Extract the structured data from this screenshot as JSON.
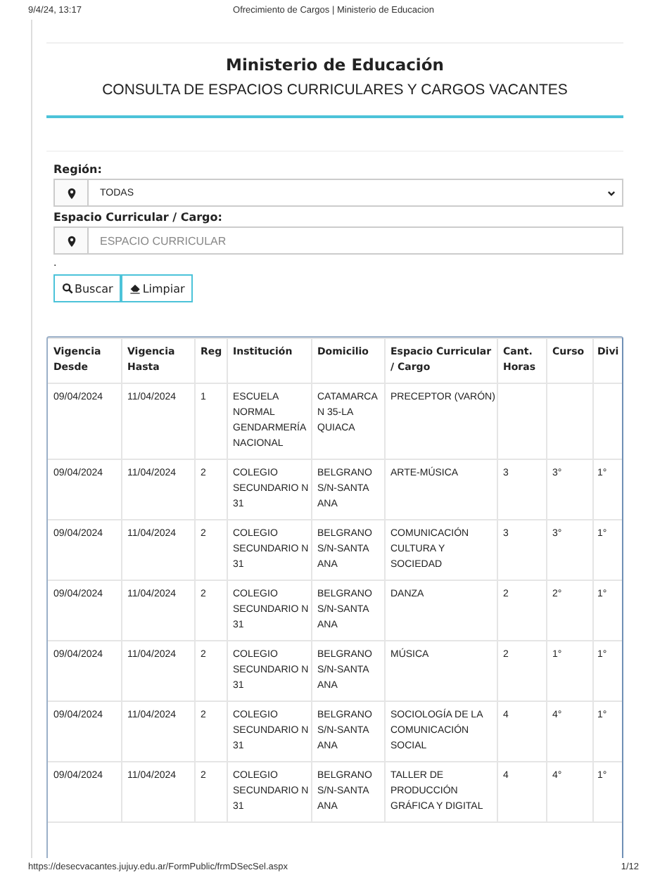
{
  "print_header": {
    "date": "9/4/24, 13:17",
    "title": "Ofrecimiento de Cargos | Ministerio de Educacion"
  },
  "heading": {
    "title": "Ministerio de Educación",
    "subtitle": "CONSULTA DE ESPACIOS CURRICULARES Y CARGOS VACANTES"
  },
  "form": {
    "fields": [
      {
        "kind": "select",
        "label": "Región:",
        "value": "TODAS"
      },
      {
        "kind": "text",
        "label": "Espacio Curricular / Cargo:",
        "placeholder": "ESPACIO CURRICULAR"
      }
    ],
    "note": ".",
    "buttons": [
      {
        "kind": "search",
        "label": "Buscar"
      },
      {
        "kind": "clear",
        "label": "Limpiar"
      }
    ]
  },
  "table": {
    "columns": [
      "Vigencia Desde",
      "Vigencia Hasta",
      "Reg",
      "Institución",
      "Domicilio",
      "Espacio Curricular / Cargo",
      "Cant. Horas",
      "Curso",
      "Divi"
    ],
    "rows": [
      [
        "09/04/2024",
        "11/04/2024",
        "1",
        "ESCUELA NORMAL GENDARMERÍA NACIONAL",
        "CATAMARCA N 35-LA QUIACA",
        "PRECEPTOR (VARÓN)",
        "",
        "",
        ""
      ],
      [
        "09/04/2024",
        "11/04/2024",
        "2",
        "COLEGIO SECUNDARIO N 31",
        "BELGRANO S/N-SANTA ANA",
        "ARTE-MÚSICA",
        "3",
        "3°",
        "1°"
      ],
      [
        "09/04/2024",
        "11/04/2024",
        "2",
        "COLEGIO SECUNDARIO N 31",
        "BELGRANO S/N-SANTA ANA",
        "COMUNICACIÓN CULTURA Y SOCIEDAD",
        "3",
        "3°",
        "1°"
      ],
      [
        "09/04/2024",
        "11/04/2024",
        "2",
        "COLEGIO SECUNDARIO N 31",
        "BELGRANO S/N-SANTA ANA",
        "DANZA",
        "2",
        "2°",
        "1°"
      ],
      [
        "09/04/2024",
        "11/04/2024",
        "2",
        "COLEGIO SECUNDARIO N 31",
        "BELGRANO S/N-SANTA ANA",
        "MÚSICA",
        "2",
        "1°",
        "1°"
      ],
      [
        "09/04/2024",
        "11/04/2024",
        "2",
        "COLEGIO SECUNDARIO N 31",
        "BELGRANO S/N-SANTA ANA",
        "SOCIOLOGÍA DE LA COMUNICACIÓN SOCIAL",
        "4",
        "4°",
        "1°"
      ],
      [
        "09/04/2024",
        "11/04/2024",
        "2",
        "COLEGIO SECUNDARIO N 31",
        "BELGRANO S/N-SANTA ANA",
        "TALLER DE PRODUCCIÓN GRÁFICA Y DIGITAL",
        "4",
        "4°",
        "1°"
      ]
    ]
  },
  "print_footer": {
    "url": "https://desecvacantes.jujuy.edu.ar/FormPublic/frmDSecSel.aspx",
    "page": "1/12"
  }
}
